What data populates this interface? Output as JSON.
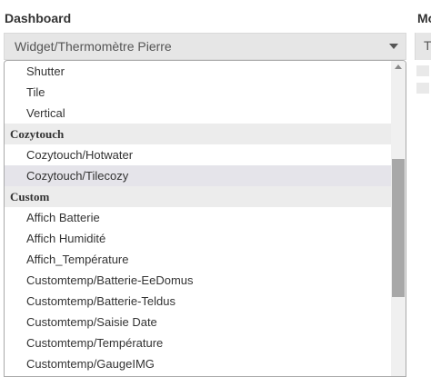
{
  "header": {
    "dashboard_label": "Dashboard",
    "right_label": "Mo"
  },
  "select": {
    "value": "Widget/Thermomètre Pierre",
    "right_value": "T"
  },
  "dropdown": {
    "items_pre": [
      "Shutter",
      "Tile",
      "Vertical"
    ],
    "group_cozytouch": "Cozytouch",
    "items_cozytouch": [
      "Cozytouch/Hotwater",
      "Cozytouch/Tilecozy"
    ],
    "group_custom": "Custom",
    "items_custom": [
      "Affich Batterie",
      "Affich Humidité",
      "Affich_Température",
      "Customtemp/Batterie-EeDomus",
      "Customtemp/Batterie-Teldus",
      "Customtemp/Saisie Date",
      "Customtemp/Température",
      "Customtemp/GaugeIMG"
    ],
    "selected": "Cozytouch/Tilecozy"
  },
  "colors": {
    "selected_bg": "#e5e4ea",
    "group_bg": "#ececec",
    "select_bg": "#e6e6e6",
    "scroll_thumb": "#a8a8a8"
  }
}
